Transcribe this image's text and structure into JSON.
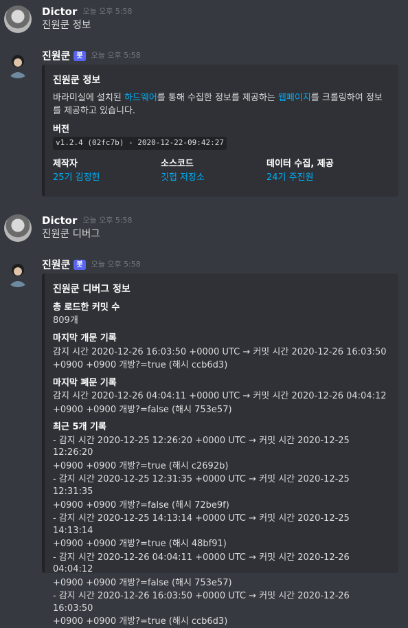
{
  "messages": [
    {
      "author": "Dictor",
      "time": "오늘 오후 5:58",
      "text": "진원쿤 정보"
    },
    {
      "author": "진원쿤",
      "bot_badge": "봇",
      "time": "오늘 오후 5:58",
      "embed": {
        "title": "진원쿤 정보",
        "desc_parts": [
          "바라미실에 설치된 ",
          "하드웨어",
          "를 통해 수집한 정보를 제공하는 ",
          "웹페이지",
          "를 크롤링하여 정보를 제공하고 있습니다."
        ],
        "version_label": "버전",
        "version_value": "v1.2.4 (02fc7b) - 2020-12-22-09:42:27",
        "cols": [
          {
            "name": "제작자",
            "value": "25기 김정현"
          },
          {
            "name": "소스코드",
            "value": "깃헙 저장소"
          },
          {
            "name": "데이터 수집, 제공",
            "value": "24기 주진원"
          }
        ]
      }
    },
    {
      "author": "Dictor",
      "time": "오늘 오후 5:58",
      "text": "진원쿤 디버그"
    },
    {
      "author": "진원쿤",
      "bot_badge": "봇",
      "time": "오늘 오후 5:58",
      "embed": {
        "title": "진원쿤 디버그 정보",
        "fields": [
          {
            "name": "총 로드한 커밋 수",
            "lines": [
              "809개"
            ]
          },
          {
            "name": "마지막 개문 기록",
            "lines": [
              "감지 시간 2020-12-26 16:03:50 +0000 UTC → 커밋 시간 2020-12-26 16:03:50",
              "+0900 +0900 개방?=true (해시 ccb6d3)"
            ]
          },
          {
            "name": "마지막 폐문 기록",
            "lines": [
              "감지 시간 2020-12-26 04:04:11 +0000 UTC → 커밋 시간 2020-12-26 04:04:12",
              "+0900 +0900 개방?=false (해시 753e57)"
            ]
          },
          {
            "name": "최근 5개 기록",
            "lines": [
              "- 감지 시간 2020-12-25 12:26:20 +0000 UTC → 커밋 시간 2020-12-25 12:26:20",
              "+0900 +0900 개방?=true (해시 c2692b)",
              "- 감지 시간 2020-12-25 12:31:35 +0000 UTC → 커밋 시간 2020-12-25 12:31:35",
              "+0900 +0900 개방?=false (해시 72be9f)",
              "- 감지 시간 2020-12-25 14:13:14 +0000 UTC → 커밋 시간 2020-12-25 14:13:14",
              "+0900 +0900 개방?=true (해시 48bf91)",
              "- 감지 시간 2020-12-26 04:04:11 +0000 UTC → 커밋 시간 2020-12-26 04:04:12",
              "+0900 +0900 개방?=false (해시 753e57)",
              "- 감지 시간 2020-12-26 16:03:50 +0000 UTC → 커밋 시간 2020-12-26 16:03:50",
              "+0900 +0900 개방?=true (해시 ccb6d3)"
            ]
          }
        ]
      }
    }
  ]
}
